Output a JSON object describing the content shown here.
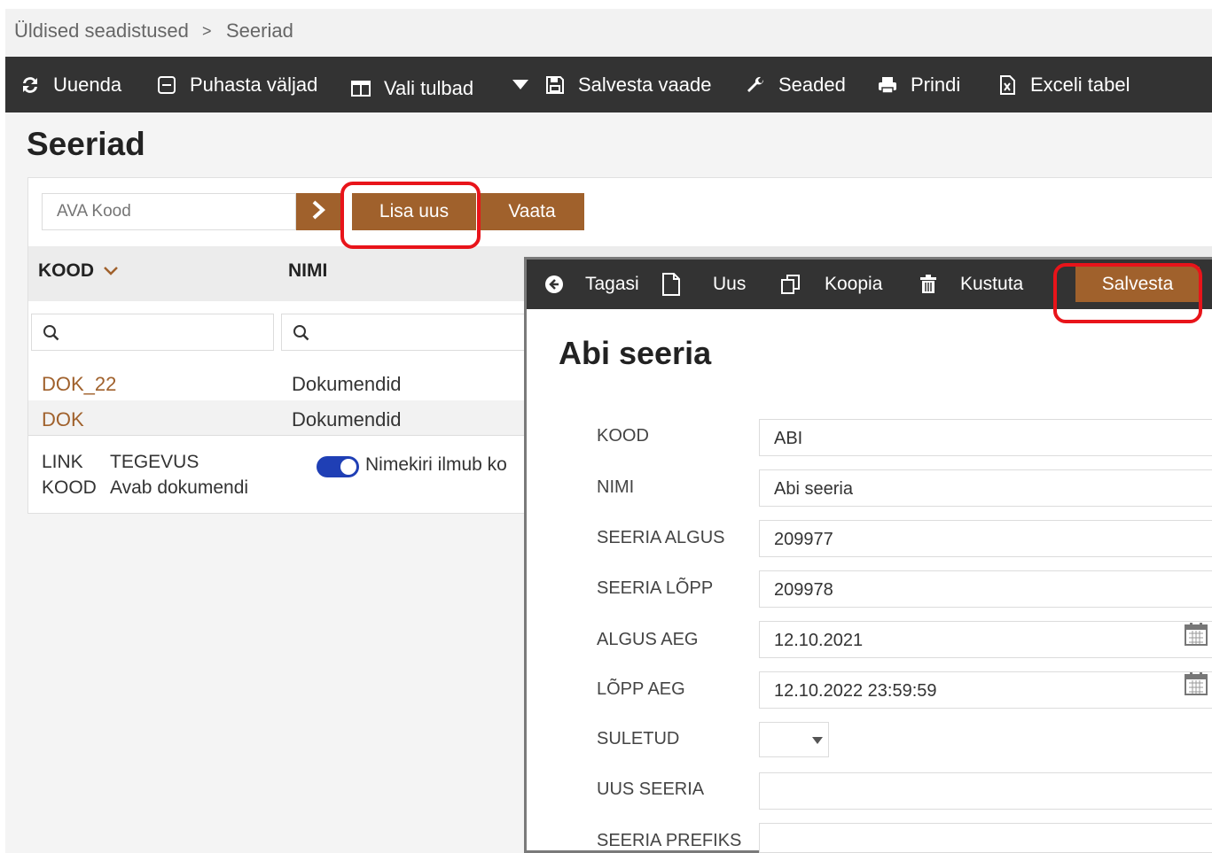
{
  "breadcrumb": {
    "parent": "Üldised seadistused",
    "separator": ">",
    "current": "Seeriad"
  },
  "toolbar": {
    "refresh": "Uuenda",
    "clear_fields": "Puhasta väljad",
    "choose_columns": "Vali tulbad",
    "save_view": "Salvesta vaade",
    "settings": "Seaded",
    "print": "Prindi",
    "excel": "Exceli tabel"
  },
  "page_title": "Seeriad",
  "search": {
    "placeholder": "AVA Kood",
    "add_new": "Lisa uus",
    "view": "Vaata"
  },
  "table": {
    "columns": {
      "code": "KOOD",
      "name": "NIMI"
    },
    "rows": [
      {
        "code": "DOK_22",
        "name": "Dokumendid"
      },
      {
        "code": "DOK",
        "name": "Dokumendid"
      }
    ],
    "legend": {
      "link": "LINK",
      "action": "TEGEVUS",
      "code": "KOOD",
      "opens": "Avab dokumendi"
    },
    "toggle_label": "Nimekiri ilmub ko"
  },
  "form": {
    "toolbar": {
      "back": "Tagasi",
      "new": "Uus",
      "copy": "Koopia",
      "delete": "Kustuta",
      "save": "Salvesta"
    },
    "title": "Abi seeria",
    "fields": {
      "kood": {
        "label": "KOOD",
        "value": "ABI"
      },
      "nimi": {
        "label": "NIMI",
        "value": "Abi seeria"
      },
      "algus": {
        "label": "SEERIA ALGUS",
        "value": "209977"
      },
      "lopp": {
        "label": "SEERIA LÕPP",
        "value": "209978"
      },
      "algus_aeg": {
        "label": "ALGUS AEG",
        "value": "12.10.2021"
      },
      "lopp_aeg": {
        "label": "LÕPP AEG",
        "value": "12.10.2022 23:59:59"
      },
      "suletud": {
        "label": "SULETUD",
        "value": ""
      },
      "uus_seeria": {
        "label": "UUS SEERIA",
        "value": ""
      },
      "prefiks": {
        "label": "SEERIA PREFIKS",
        "value": ""
      }
    }
  },
  "colors": {
    "brown": "#a0612c",
    "toolbar": "#333333",
    "link": "#a0612c",
    "toggle": "#1f3fb5",
    "annotation": "#e8141a"
  }
}
